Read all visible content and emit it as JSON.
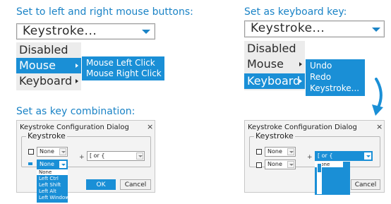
{
  "left_top": {
    "heading": "Set to left and right mouse buttons:",
    "select_value": "Keystroke...",
    "menu": [
      "Disabled",
      "Mouse",
      "Keyboard"
    ],
    "submenu": [
      "Mouse Left Click",
      "Mouse Right Click"
    ]
  },
  "right_top": {
    "heading": "Set as keyboard key:",
    "select_value": "Keystroke...",
    "menu": [
      "Disabled",
      "Mouse",
      "Keyboard"
    ],
    "submenu": [
      "Undo",
      "Redo",
      "Keystroke..."
    ]
  },
  "left_bottom": {
    "heading": "Set as key combination:",
    "dialog_title": "Keystroke Configuration Dialog",
    "close_glyph": "×",
    "group_label": "Keystroke",
    "dropdown1": "None",
    "dropdown2": "None",
    "plus": "+",
    "key_value": "[ or {",
    "list": [
      "None",
      "Left Ctrl",
      "Left Shift",
      "Left Alt",
      "Left Windows"
    ],
    "ok": "OK",
    "cancel": "Cancel"
  },
  "right_bottom": {
    "dialog_title": "Keystroke Configuration Dialog",
    "close_glyph": "×",
    "group_label": "Keystroke",
    "dropdown1": "None",
    "dropdown2": "None",
    "plus": "+",
    "key_value": "[ or {",
    "list": [
      "None",
      "A",
      "B",
      "C",
      "D"
    ],
    "cancel": "Cancel"
  },
  "colors": {
    "accent": "#1a8fd6",
    "heading": "#1a83c6"
  }
}
